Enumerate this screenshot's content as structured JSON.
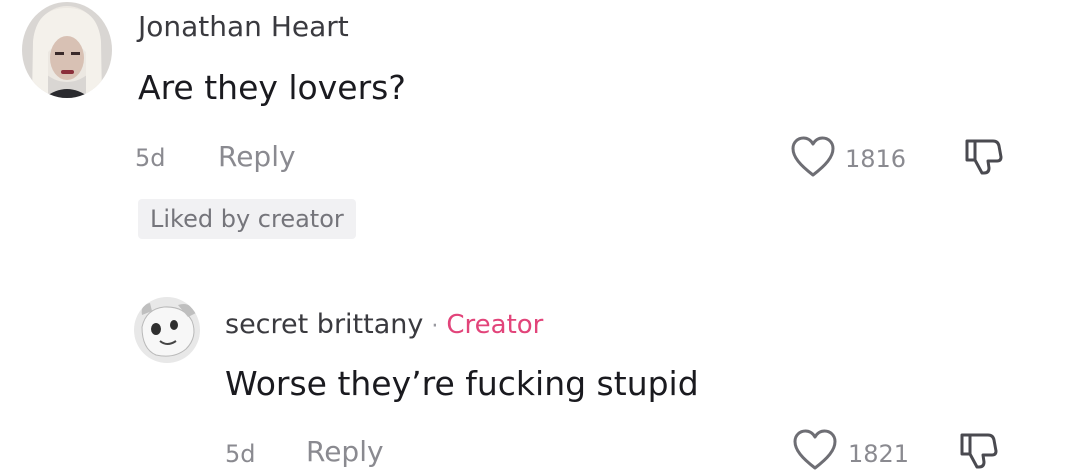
{
  "comments": [
    {
      "username": "Jonathan Heart",
      "text": "Are they lovers?",
      "age": "5d",
      "reply_label": "Reply",
      "likes": "1816",
      "badge": "Liked by creator",
      "avatar_icon": "user-avatar-blonde"
    },
    {
      "username": "secret brittany",
      "separator": "·",
      "role_tag": "Creator",
      "text": "Worse they’re fucking stupid",
      "age": "5d",
      "reply_label": "Reply",
      "likes": "1821",
      "avatar_icon": "user-avatar-dog"
    }
  ],
  "icons": {
    "like": "heart-outline-icon",
    "dislike": "thumbs-down-icon"
  },
  "colors": {
    "creator_tag": "#e2447a",
    "muted_text": "#8a8a90",
    "badge_bg": "#f1f1f3"
  }
}
